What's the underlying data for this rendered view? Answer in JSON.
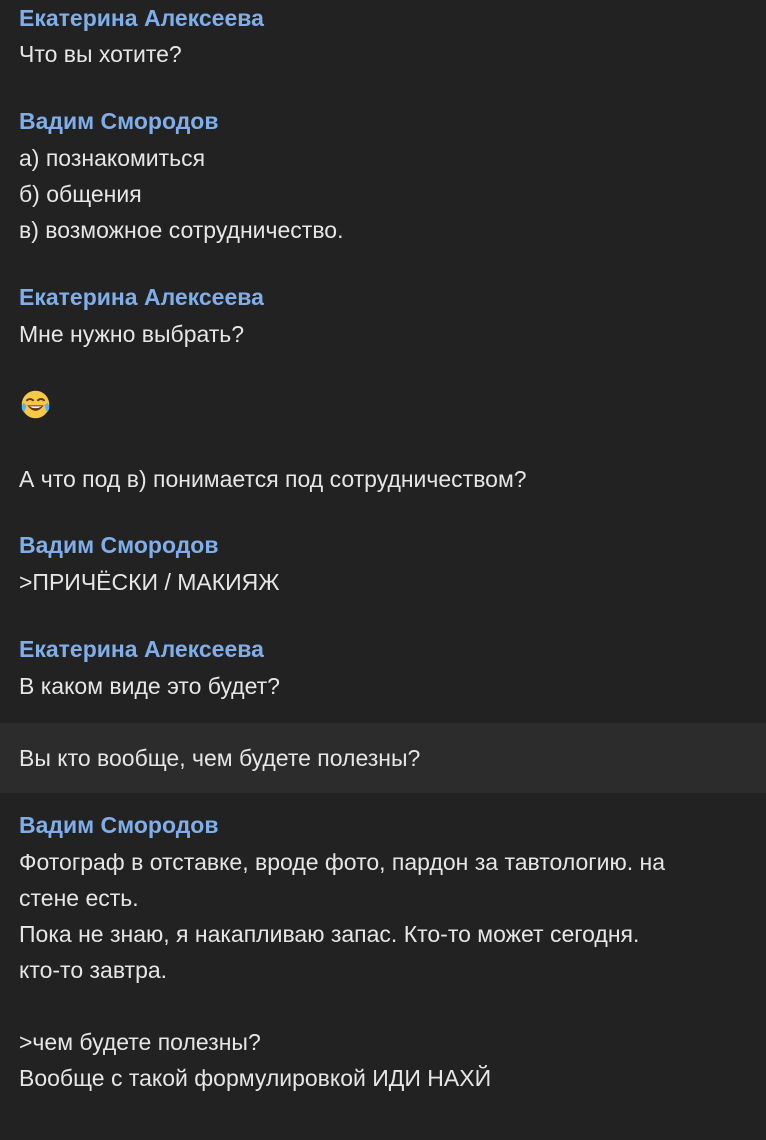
{
  "messages": [
    {
      "author": "Екатерина Алексеева",
      "lines": [
        "Что вы хотите?"
      ]
    },
    {
      "author": "Вадим Смородов",
      "lines": [
        "а) познакомиться",
        "б) общения",
        "в) возможное сотрудничество."
      ]
    },
    {
      "author": "Екатерина Алексеева",
      "lines": [
        "Мне нужно выбрать?"
      ],
      "emoji": "face-with-tears-of-joy",
      "lines_after": [
        "А что под в) понимается под сотрудничеством?"
      ]
    },
    {
      "author": "Вадим Смородов",
      "lines": [
        ">ПРИЧЁСКИ / МАКИЯЖ"
      ]
    },
    {
      "author": "Екатерина Алексеева",
      "lines": [
        "В каком виде это будет?"
      ],
      "highlighted_line": "Вы кто вообще,  чем будете полезны?"
    },
    {
      "author": "Вадим Смородов",
      "lines": [
        "Фотограф в отставке, вроде фото, пардон за тавтологию. на",
        "стене есть.",
        "Пока не знаю, я накапливаю запас. Кто-то может сегодня.",
        "кто-то завтра.",
        ">чем будете полезны?",
        "Вообще с такой формулировкой ИДИ НАХЙ"
      ]
    }
  ],
  "colors": {
    "background": "#222222",
    "author": "#7faee8",
    "text": "#e6e6e6",
    "highlight": "#2c2c2c"
  }
}
